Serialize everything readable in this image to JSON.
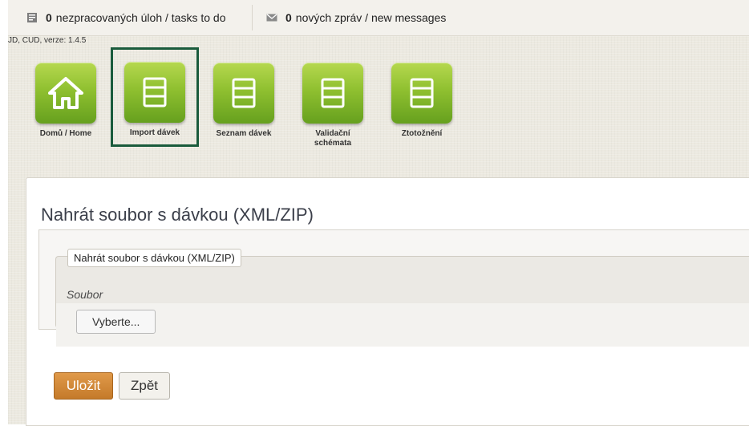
{
  "topbar": {
    "tasks": {
      "count": "0",
      "label": "nezpracovaných úloh / tasks to do",
      "icon": "tasks-icon"
    },
    "messages": {
      "count": "0",
      "label": "nových zpráv / new messages",
      "icon": "envelope-icon"
    }
  },
  "version": "JD, CUD, verze: 1.4.5",
  "nav": {
    "items": [
      {
        "label": "Domů / Home",
        "icon": "home-icon"
      },
      {
        "label": "Import dávek",
        "icon": "list-icon",
        "selected": true
      },
      {
        "label": "Seznam dávek",
        "icon": "list-icon"
      },
      {
        "label": "Validační schémata",
        "icon": "list-icon"
      },
      {
        "label": "Ztotožnění",
        "icon": "list-icon"
      }
    ]
  },
  "main": {
    "title": "Nahrát soubor s dávkou (XML/ZIP)",
    "fieldset_legend": "Nahrát soubor s dávkou (XML/ZIP)",
    "field_label": "Soubor",
    "browse_label": "Vyberte...",
    "save_label": "Uložit",
    "back_label": "Zpět"
  },
  "colors": {
    "nav_green": "#8fc030",
    "selected_outline": "#1a5b3c",
    "save_orange": "#d38a3a"
  }
}
